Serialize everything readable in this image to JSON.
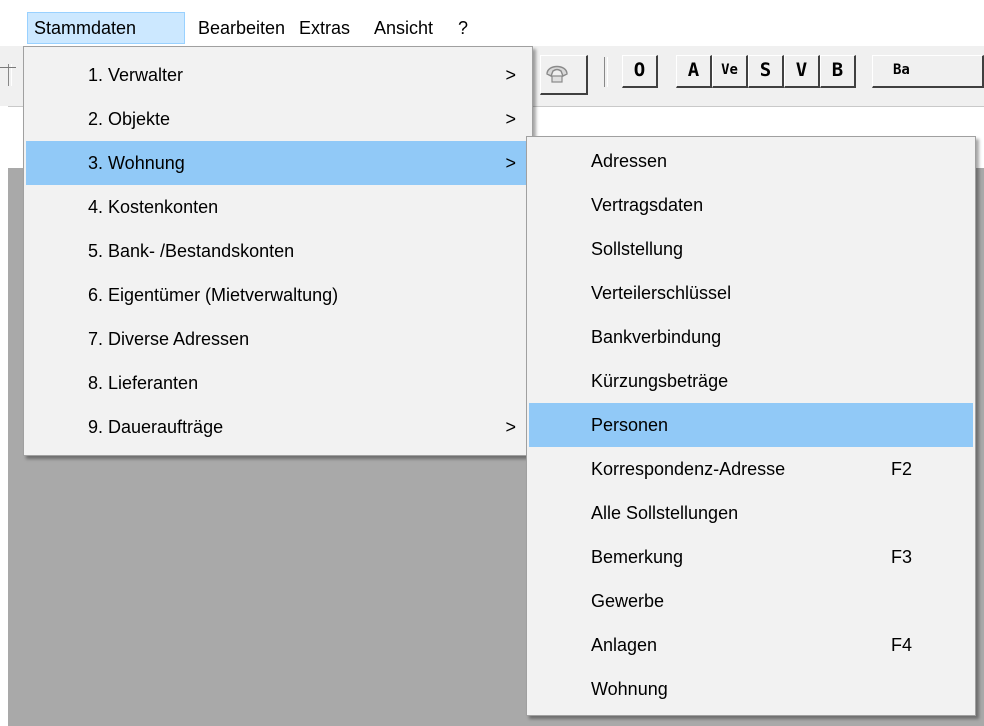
{
  "menubar": {
    "items": [
      "Stammdaten",
      "Bearbeiten",
      "Extras",
      "Ansicht",
      "?"
    ]
  },
  "toolbar": {
    "buttons": [
      "O",
      "A",
      "Ve",
      "S",
      "V",
      "B",
      "Ba"
    ]
  },
  "icons": {
    "submenu_arrow": ">",
    "phone": "phone-icon"
  },
  "stammdaten_menu": {
    "items": [
      {
        "label": "1. Verwalter",
        "submenu": ">"
      },
      {
        "label": "2. Objekte",
        "submenu": ">"
      },
      {
        "label": "3. Wohnung",
        "submenu": ">"
      },
      {
        "label": "4. Kostenkonten"
      },
      {
        "label": "5. Bank- /Bestandskonten"
      },
      {
        "label": "6. Eigentümer (Mietverwaltung)"
      },
      {
        "label": "7. Diverse Adressen"
      },
      {
        "label": "8. Lieferanten"
      },
      {
        "label": "9. Daueraufträge",
        "submenu": ">"
      }
    ],
    "highlighted": "3. Wohnung"
  },
  "wohnung_submenu": {
    "items": [
      {
        "label": "Adressen"
      },
      {
        "label": "Vertragsdaten"
      },
      {
        "label": "Sollstellung"
      },
      {
        "label": "Verteilerschlüssel"
      },
      {
        "label": "Bankverbindung"
      },
      {
        "label": "Kürzungsbeträge"
      },
      {
        "label": "Personen"
      },
      {
        "label": "Korrespondenz-Adresse",
        "shortcut": "F2"
      },
      {
        "label": "Alle Sollstellungen"
      },
      {
        "label": "Bemerkung",
        "shortcut": "F3"
      },
      {
        "label": "Gewerbe"
      },
      {
        "label": "Anlagen",
        "shortcut": "F4"
      },
      {
        "label": "Wohnung"
      }
    ],
    "highlighted": "Personen"
  },
  "colors": {
    "menu_highlight": "#91c9f7",
    "menubar_active": "#cce8ff",
    "workspace": "#a9a9a9",
    "menu_bg": "#f2f2f2"
  }
}
